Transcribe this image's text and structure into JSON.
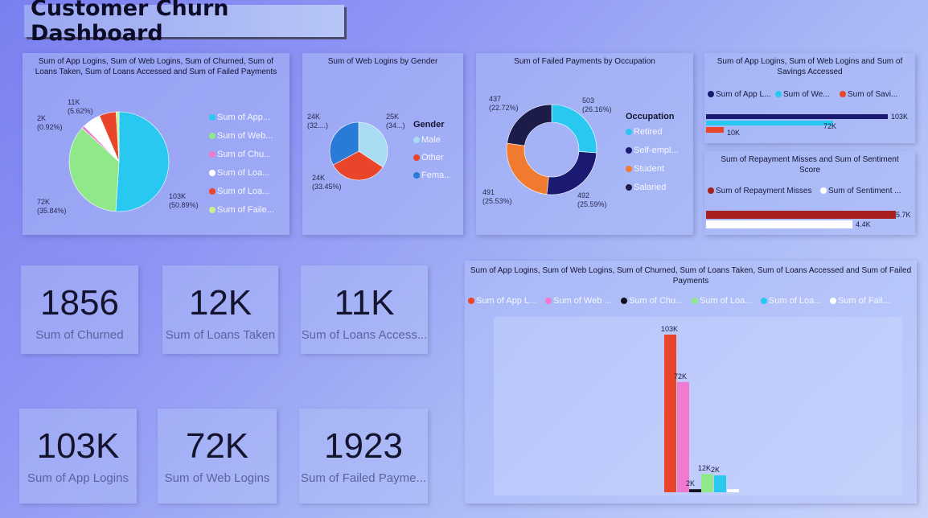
{
  "header": {
    "title": "Customer Churn Dashboard"
  },
  "pie_card": {
    "title": "Sum of App Logins, Sum of Web Logins, Sum of Churned, Sum of Loans Taken, Sum of Loans Accessed and Sum of Failed Payments",
    "legend": [
      "Sum of App...",
      "Sum of Web...",
      "Sum of Chu...",
      "Sum of Loa...",
      "Sum of Loa...",
      "Sum of Faile..."
    ],
    "labels": {
      "app": "103K\n(50.89%)",
      "web": "72K\n(35.84%)",
      "churned": "2K\n(0.92%)",
      "loans_taken": "11K\n(5.62%)"
    }
  },
  "gender_card": {
    "title": "Sum of Web Logins by Gender",
    "legend_title": "Gender",
    "legend": [
      "Male",
      "Other",
      "Fema..."
    ],
    "labels": {
      "male": "25K\n(34...)",
      "female": "24K\n(32....)",
      "other": "24K\n(33.45%)"
    }
  },
  "occupation_card": {
    "title": "Sum of Failed Payments by Occupation",
    "legend_title": "Occupation",
    "legend": [
      "Retired",
      "Self-empl...",
      "Student",
      "Salaried"
    ],
    "labels": {
      "retired": "503\n(26.16%)",
      "self": "492\n(25.59%)",
      "student": "491\n(25.53%)",
      "salaried": "437\n(22.72%)"
    }
  },
  "savings_card": {
    "title": "Sum of App Logins, Sum of Web Logins and Sum of Savings Accessed",
    "legend": [
      "Sum of App L...",
      "Sum of We...",
      "Sum of Savi..."
    ],
    "values": [
      "103K",
      "72K",
      "10K"
    ]
  },
  "repayment_card": {
    "title": "Sum of Repayment Misses and Sum of Sentiment Score",
    "legend": [
      "Sum of Repayment Misses",
      "Sum of Sentiment ..."
    ],
    "values": [
      "5.7K",
      "4.4K"
    ]
  },
  "kpis": [
    {
      "value": "1856",
      "label": "Sum of Churned"
    },
    {
      "value": "12K",
      "label": "Sum of Loans Taken"
    },
    {
      "value": "11K",
      "label": "Sum of Loans Access..."
    },
    {
      "value": "103K",
      "label": "Sum of App Logins"
    },
    {
      "value": "72K",
      "label": "Sum of Web Logins"
    },
    {
      "value": "1923",
      "label": "Sum of Failed Payme..."
    }
  ],
  "bar_card": {
    "title": "Sum of App Logins, Sum of Web Logins, Sum of Churned, Sum of Loans Taken, Sum of Loans Accessed and Sum of Failed Payments",
    "legend": [
      "Sum of App L...",
      "Sum of Web ...",
      "Sum of Chu...",
      "Sum of Loa...",
      "Sum of Loa...",
      "Sum of Fail..."
    ]
  },
  "colors": {
    "cyan": "#28c8f0",
    "green": "#8fe88a",
    "pink": "#f07ad0",
    "white": "#ffffff",
    "red": "#e8452a",
    "lime": "#c8f090",
    "navy": "#1a1a70",
    "orange": "#f07a30",
    "blue": "#2a7ad8",
    "lightblue": "#a9dcf2",
    "darkred": "#a82020"
  },
  "chart_data": [
    {
      "type": "pie",
      "categories": [
        "Sum of App Logins",
        "Sum of Web Logins",
        "Sum of Churned",
        "Sum of Loans Taken",
        "Sum of Loans Accessed",
        "Sum of Failed Payments"
      ],
      "values": [
        103000,
        72000,
        1856,
        12000,
        11000,
        1923
      ],
      "percent": [
        50.89,
        35.84,
        0.92,
        5.62,
        5.62,
        0.95
      ]
    },
    {
      "type": "pie",
      "categories": [
        "Male",
        "Other",
        "Female"
      ],
      "values": [
        25000,
        24000,
        24000
      ],
      "percent": [
        34,
        33.45,
        32
      ]
    },
    {
      "type": "pie",
      "categories": [
        "Retired",
        "Self-employed",
        "Student",
        "Salaried"
      ],
      "values": [
        503,
        492,
        491,
        437
      ],
      "percent": [
        26.16,
        25.59,
        25.53,
        22.72
      ]
    },
    {
      "type": "bar",
      "categories": [
        "Sum of App Logins",
        "Sum of Web Logins",
        "Sum of Savings Accessed"
      ],
      "values": [
        103000,
        72000,
        10000
      ]
    },
    {
      "type": "bar",
      "categories": [
        "Sum of Repayment Misses",
        "Sum of Sentiment Score"
      ],
      "values": [
        5700,
        4400
      ]
    },
    {
      "type": "bar",
      "series": [
        {
          "name": "Sum of App Logins",
          "values": [
            103000
          ]
        },
        {
          "name": "Sum of Web Logins",
          "values": [
            72000
          ]
        },
        {
          "name": "Sum of Churned",
          "values": [
            2000
          ]
        },
        {
          "name": "Sum of Loans Taken",
          "values": [
            12000
          ]
        },
        {
          "name": "Sum of Loans Accessed",
          "values": [
            11000
          ]
        },
        {
          "name": "Sum of Failed Payments",
          "values": [
            2000
          ]
        }
      ],
      "data_labels": [
        "103K",
        "72K",
        "2K",
        "12K",
        "2K"
      ]
    }
  ]
}
